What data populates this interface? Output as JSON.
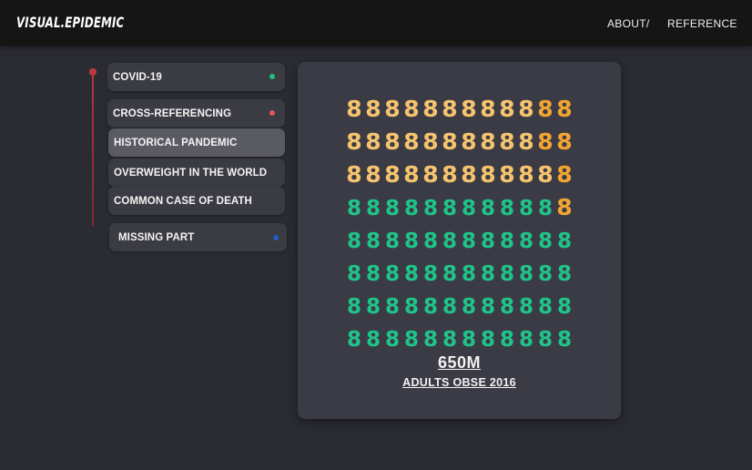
{
  "header": {
    "logo": "VISUAL.EPIDEMIC",
    "nav": {
      "about": "ABOUT/",
      "reference": "REFERENCE"
    }
  },
  "sidebar": {
    "items": [
      {
        "label": "COVID-19",
        "dot_color": "#1fc27d",
        "active": false
      },
      {
        "label": "CROSS-REFERENCING",
        "dot_color": "#e0575a",
        "active": false
      },
      {
        "label": "HISTORICAL PANDEMIC",
        "dot_color": null,
        "active": true
      },
      {
        "label": "OVERWEIGHT IN THE WORLD",
        "dot_color": null,
        "active": false
      },
      {
        "label": "COMMON CASE OF DEATH",
        "dot_color": null,
        "active": false
      },
      {
        "label": "MISSING PART",
        "dot_color": "#1f5fc2",
        "active": false
      }
    ]
  },
  "grid": {
    "glyph": "8",
    "rows": 8,
    "cols": 12,
    "orange_per_row": [
      2,
      2,
      1,
      1,
      0,
      0,
      0,
      0
    ],
    "yellow_per_row": [
      10,
      10,
      11,
      0,
      0,
      0,
      0,
      0
    ],
    "colors": {
      "yellow": "#f6c46e",
      "orange": "#f2a531",
      "green": "#1fc48a"
    }
  },
  "stat": {
    "value": "650M",
    "label": "ADULTS OBSE 2016"
  }
}
